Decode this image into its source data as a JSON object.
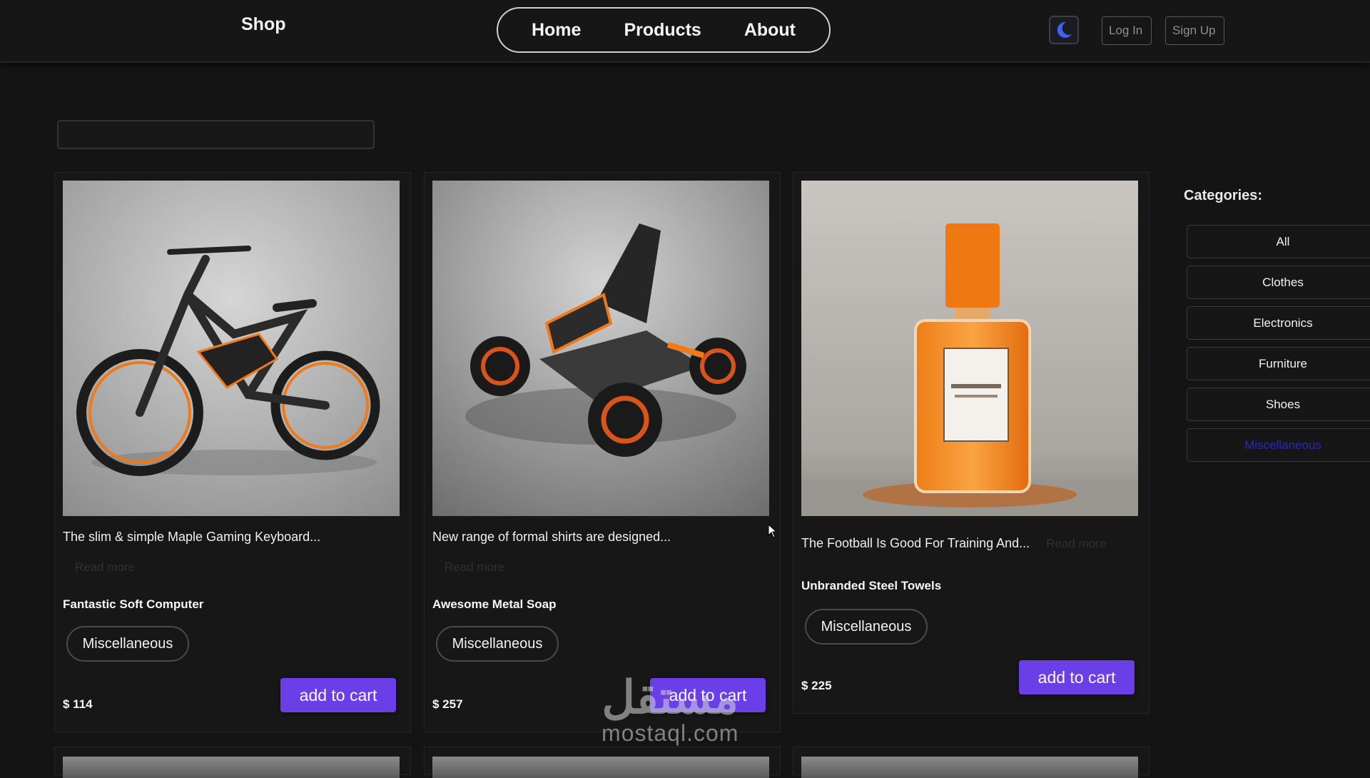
{
  "header": {
    "brand": "Shop",
    "nav": [
      "Home",
      "Products",
      "About"
    ],
    "theme_icon": "moon-icon",
    "login_label": "Log In",
    "signup_label": "Sign Up"
  },
  "search": {
    "value": "",
    "placeholder": ""
  },
  "products": [
    {
      "description": "The slim & simple Maple Gaming Keyboard...",
      "read_more": "Read more",
      "title": "Fantastic Soft Computer",
      "category": "Miscellaneous",
      "price": "$ 114",
      "cart_label": "add to cart",
      "image": "electric-bike-image"
    },
    {
      "description": "New range of formal shirts are designed...",
      "read_more": "Read more",
      "title": "Awesome Metal Soap",
      "category": "Miscellaneous",
      "price": "$ 257",
      "cart_label": "add to cart",
      "image": "go-kart-image"
    },
    {
      "description": "The Football Is Good For Training And...",
      "read_more": "Read more",
      "title": "Unbranded Steel Towels",
      "category": "Miscellaneous",
      "price": "$ 225",
      "cart_label": "add to cart",
      "image": "perfume-bottle-image"
    }
  ],
  "categories": {
    "heading": "Categories:",
    "items": [
      "All",
      "Clothes",
      "Electronics",
      "Furniture",
      "Shoes",
      "Miscellaneous"
    ],
    "active": "Miscellaneous"
  },
  "watermark": {
    "arabic": "مستقل",
    "url": "mostaql.com"
  },
  "colors": {
    "accent": "#6a3fe8",
    "background": "#141414",
    "active_category": "#2d29b8",
    "theme_icon": "#3d63f5"
  }
}
